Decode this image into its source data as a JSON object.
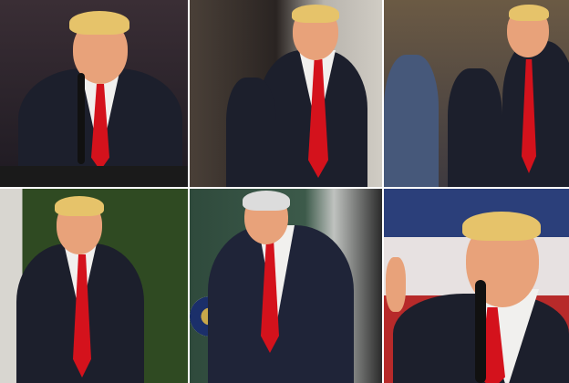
{
  "collage": {
    "panel_count": 6,
    "colors": {
      "suit": "#1c1f2c",
      "tie": "#d4121c",
      "shirt": "#f1f0ee",
      "hair": "#e6c36a",
      "skin": "#e8a27a"
    }
  }
}
